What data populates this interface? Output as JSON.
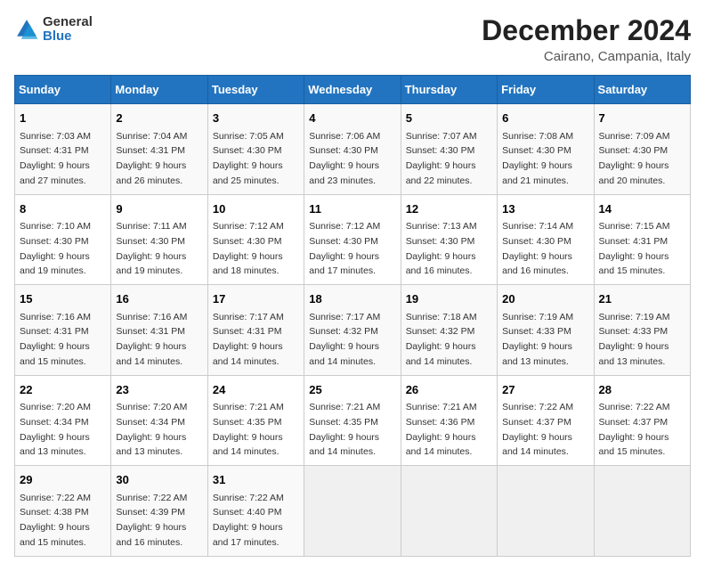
{
  "logo": {
    "line1": "General",
    "line2": "Blue"
  },
  "title": "December 2024",
  "location": "Cairano, Campania, Italy",
  "days_header": [
    "Sunday",
    "Monday",
    "Tuesday",
    "Wednesday",
    "Thursday",
    "Friday",
    "Saturday"
  ],
  "weeks": [
    [
      {
        "day": "1",
        "sunrise": "Sunrise: 7:03 AM",
        "sunset": "Sunset: 4:31 PM",
        "daylight": "Daylight: 9 hours and 27 minutes."
      },
      {
        "day": "2",
        "sunrise": "Sunrise: 7:04 AM",
        "sunset": "Sunset: 4:31 PM",
        "daylight": "Daylight: 9 hours and 26 minutes."
      },
      {
        "day": "3",
        "sunrise": "Sunrise: 7:05 AM",
        "sunset": "Sunset: 4:30 PM",
        "daylight": "Daylight: 9 hours and 25 minutes."
      },
      {
        "day": "4",
        "sunrise": "Sunrise: 7:06 AM",
        "sunset": "Sunset: 4:30 PM",
        "daylight": "Daylight: 9 hours and 23 minutes."
      },
      {
        "day": "5",
        "sunrise": "Sunrise: 7:07 AM",
        "sunset": "Sunset: 4:30 PM",
        "daylight": "Daylight: 9 hours and 22 minutes."
      },
      {
        "day": "6",
        "sunrise": "Sunrise: 7:08 AM",
        "sunset": "Sunset: 4:30 PM",
        "daylight": "Daylight: 9 hours and 21 minutes."
      },
      {
        "day": "7",
        "sunrise": "Sunrise: 7:09 AM",
        "sunset": "Sunset: 4:30 PM",
        "daylight": "Daylight: 9 hours and 20 minutes."
      }
    ],
    [
      {
        "day": "8",
        "sunrise": "Sunrise: 7:10 AM",
        "sunset": "Sunset: 4:30 PM",
        "daylight": "Daylight: 9 hours and 19 minutes."
      },
      {
        "day": "9",
        "sunrise": "Sunrise: 7:11 AM",
        "sunset": "Sunset: 4:30 PM",
        "daylight": "Daylight: 9 hours and 19 minutes."
      },
      {
        "day": "10",
        "sunrise": "Sunrise: 7:12 AM",
        "sunset": "Sunset: 4:30 PM",
        "daylight": "Daylight: 9 hours and 18 minutes."
      },
      {
        "day": "11",
        "sunrise": "Sunrise: 7:12 AM",
        "sunset": "Sunset: 4:30 PM",
        "daylight": "Daylight: 9 hours and 17 minutes."
      },
      {
        "day": "12",
        "sunrise": "Sunrise: 7:13 AM",
        "sunset": "Sunset: 4:30 PM",
        "daylight": "Daylight: 9 hours and 16 minutes."
      },
      {
        "day": "13",
        "sunrise": "Sunrise: 7:14 AM",
        "sunset": "Sunset: 4:30 PM",
        "daylight": "Daylight: 9 hours and 16 minutes."
      },
      {
        "day": "14",
        "sunrise": "Sunrise: 7:15 AM",
        "sunset": "Sunset: 4:31 PM",
        "daylight": "Daylight: 9 hours and 15 minutes."
      }
    ],
    [
      {
        "day": "15",
        "sunrise": "Sunrise: 7:16 AM",
        "sunset": "Sunset: 4:31 PM",
        "daylight": "Daylight: 9 hours and 15 minutes."
      },
      {
        "day": "16",
        "sunrise": "Sunrise: 7:16 AM",
        "sunset": "Sunset: 4:31 PM",
        "daylight": "Daylight: 9 hours and 14 minutes."
      },
      {
        "day": "17",
        "sunrise": "Sunrise: 7:17 AM",
        "sunset": "Sunset: 4:31 PM",
        "daylight": "Daylight: 9 hours and 14 minutes."
      },
      {
        "day": "18",
        "sunrise": "Sunrise: 7:17 AM",
        "sunset": "Sunset: 4:32 PM",
        "daylight": "Daylight: 9 hours and 14 minutes."
      },
      {
        "day": "19",
        "sunrise": "Sunrise: 7:18 AM",
        "sunset": "Sunset: 4:32 PM",
        "daylight": "Daylight: 9 hours and 14 minutes."
      },
      {
        "day": "20",
        "sunrise": "Sunrise: 7:19 AM",
        "sunset": "Sunset: 4:33 PM",
        "daylight": "Daylight: 9 hours and 13 minutes."
      },
      {
        "day": "21",
        "sunrise": "Sunrise: 7:19 AM",
        "sunset": "Sunset: 4:33 PM",
        "daylight": "Daylight: 9 hours and 13 minutes."
      }
    ],
    [
      {
        "day": "22",
        "sunrise": "Sunrise: 7:20 AM",
        "sunset": "Sunset: 4:34 PM",
        "daylight": "Daylight: 9 hours and 13 minutes."
      },
      {
        "day": "23",
        "sunrise": "Sunrise: 7:20 AM",
        "sunset": "Sunset: 4:34 PM",
        "daylight": "Daylight: 9 hours and 13 minutes."
      },
      {
        "day": "24",
        "sunrise": "Sunrise: 7:21 AM",
        "sunset": "Sunset: 4:35 PM",
        "daylight": "Daylight: 9 hours and 14 minutes."
      },
      {
        "day": "25",
        "sunrise": "Sunrise: 7:21 AM",
        "sunset": "Sunset: 4:35 PM",
        "daylight": "Daylight: 9 hours and 14 minutes."
      },
      {
        "day": "26",
        "sunrise": "Sunrise: 7:21 AM",
        "sunset": "Sunset: 4:36 PM",
        "daylight": "Daylight: 9 hours and 14 minutes."
      },
      {
        "day": "27",
        "sunrise": "Sunrise: 7:22 AM",
        "sunset": "Sunset: 4:37 PM",
        "daylight": "Daylight: 9 hours and 14 minutes."
      },
      {
        "day": "28",
        "sunrise": "Sunrise: 7:22 AM",
        "sunset": "Sunset: 4:37 PM",
        "daylight": "Daylight: 9 hours and 15 minutes."
      }
    ],
    [
      {
        "day": "29",
        "sunrise": "Sunrise: 7:22 AM",
        "sunset": "Sunset: 4:38 PM",
        "daylight": "Daylight: 9 hours and 15 minutes."
      },
      {
        "day": "30",
        "sunrise": "Sunrise: 7:22 AM",
        "sunset": "Sunset: 4:39 PM",
        "daylight": "Daylight: 9 hours and 16 minutes."
      },
      {
        "day": "31",
        "sunrise": "Sunrise: 7:22 AM",
        "sunset": "Sunset: 4:40 PM",
        "daylight": "Daylight: 9 hours and 17 minutes."
      },
      null,
      null,
      null,
      null
    ]
  ]
}
